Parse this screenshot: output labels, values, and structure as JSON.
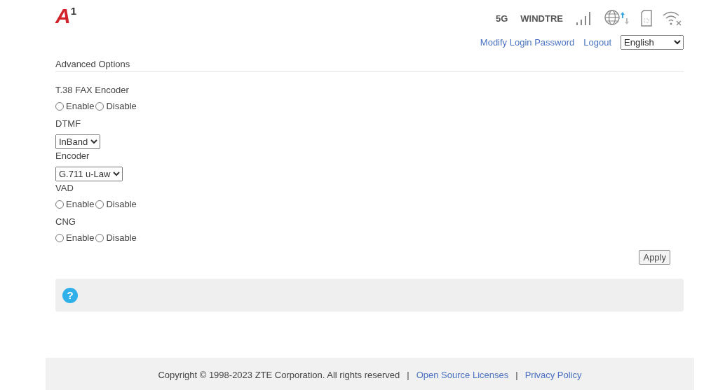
{
  "logo": {
    "letter": "A",
    "mark": "1"
  },
  "status": {
    "network": "5G",
    "carrier": "WINDTRE"
  },
  "header_links": [
    {
      "label": "Modify Login Password"
    },
    {
      "label": "Logout"
    }
  ],
  "language": {
    "value": "English"
  },
  "section_title": "Advanced Options",
  "fields": [
    {
      "kind": "radio",
      "label": "T.38 FAX Encoder",
      "options": [
        {
          "label": "Enable",
          "selected": false
        },
        {
          "label": "Disable",
          "selected": false
        }
      ]
    },
    {
      "kind": "select",
      "label": "DTMF",
      "value": "InBand"
    },
    {
      "kind": "select",
      "label": "Encoder",
      "value": "G.711 u-Law"
    },
    {
      "kind": "radio",
      "label": "VAD",
      "options": [
        {
          "label": "Enable",
          "selected": false
        },
        {
          "label": "Disable",
          "selected": false
        }
      ]
    },
    {
      "kind": "radio",
      "label": "CNG",
      "options": [
        {
          "label": "Enable",
          "selected": false
        },
        {
          "label": "Disable",
          "selected": false
        }
      ]
    }
  ],
  "apply_button": "Apply",
  "help": {
    "icon": "?"
  },
  "footer": {
    "copyright": "Copyright © 1998-2023 ZTE Corporation. All rights reserved",
    "items": [
      {
        "kind": "separator",
        "text": "|"
      },
      {
        "kind": "link",
        "text": "Open Source Licenses"
      },
      {
        "kind": "separator",
        "text": "|"
      },
      {
        "kind": "link",
        "text": "Privacy Policy"
      }
    ]
  }
}
